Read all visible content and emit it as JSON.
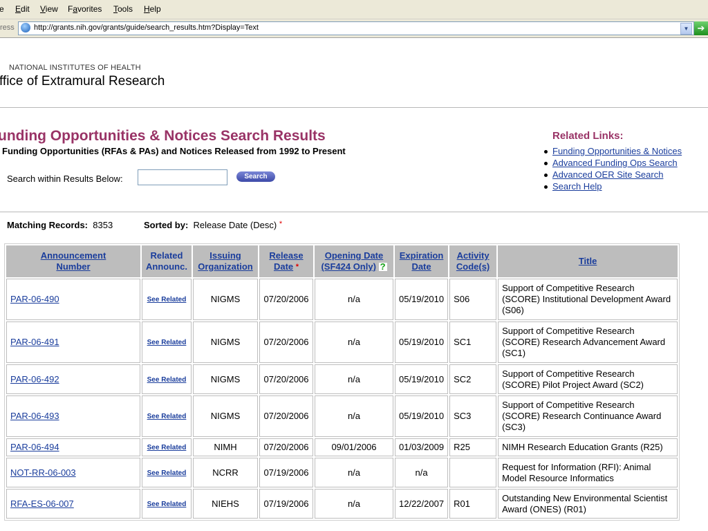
{
  "menu": {
    "items": [
      {
        "prefix": "",
        "key": "",
        "rest": "e"
      },
      {
        "prefix": "",
        "key": "E",
        "rest": "dit"
      },
      {
        "prefix": "",
        "key": "V",
        "rest": "iew"
      },
      {
        "prefix": "F",
        "key": "a",
        "rest": "vorites"
      },
      {
        "prefix": "",
        "key": "T",
        "rest": "ools"
      },
      {
        "prefix": "",
        "key": "H",
        "rest": "elp"
      }
    ]
  },
  "address": {
    "label": "ress",
    "url": "http://grants.nih.gov/grants/guide/search_results.htm?Display=Text",
    "go_icon": "go-arrow-icon"
  },
  "header": {
    "agency": "NATIONAL INSTITUTES OF HEALTH",
    "office": "ffice of Extramural Research"
  },
  "search": {
    "title": "unding Opportunities & Notices Search Results",
    "subtitle": "Funding Opportunities (RFAs & PAs) and Notices Released from 1992 to Present",
    "label": "Search within Results Below:",
    "value": "",
    "button": "Search"
  },
  "related": {
    "title": "Related Links:",
    "links": [
      "Funding Opportunities & Notices",
      "Advanced Funding Ops Search",
      "Advanced OER Site Search",
      "Search Help"
    ]
  },
  "summary": {
    "matching_label": "Matching Records:",
    "matching_value": "8353",
    "sorted_label": "Sorted by:",
    "sorted_value": "Release Date (Desc)",
    "star": "*"
  },
  "table": {
    "headers": {
      "announcement_l1": "Announcement",
      "announcement_l2": "Number",
      "related_l1": "Related",
      "related_l2": "Announc.",
      "issuing_l1": "Issuing",
      "issuing_l2": "Organization",
      "release_l1": "Release",
      "release_l2": "Date",
      "opening_l1": "Opening Date",
      "opening_l2": "(SF424 Only)",
      "opening_q": "?",
      "expiration_l1": "Expiration",
      "expiration_l2": "Date",
      "activity_l1": "Activity",
      "activity_l2": "Code(s)",
      "title": "Title",
      "star": "*"
    },
    "rows": [
      {
        "number": "PAR-06-490",
        "related": "See Related",
        "org": "NIGMS",
        "release": "07/20/2006",
        "opening": "n/a",
        "expiration": "05/19/2010",
        "activity": "S06",
        "title": "Support of Competitive Research (SCORE) Institutional Development Award (S06)"
      },
      {
        "number": "PAR-06-491",
        "related": "See Related",
        "org": "NIGMS",
        "release": "07/20/2006",
        "opening": "n/a",
        "expiration": "05/19/2010",
        "activity": "SC1",
        "title": "Support of Competitive Research (SCORE) Research Advancement Award (SC1)"
      },
      {
        "number": "PAR-06-492",
        "related": "See Related",
        "org": "NIGMS",
        "release": "07/20/2006",
        "opening": "n/a",
        "expiration": "05/19/2010",
        "activity": "SC2",
        "title": "Support of Competitive Research (SCORE) Pilot Project Award (SC2)"
      },
      {
        "number": "PAR-06-493",
        "related": "See Related",
        "org": "NIGMS",
        "release": "07/20/2006",
        "opening": "n/a",
        "expiration": "05/19/2010",
        "activity": "SC3",
        "title": "Support of Competitive Research (SCORE) Research Continuance Award (SC3)"
      },
      {
        "number": "PAR-06-494",
        "related": "See Related",
        "org": "NIMH",
        "release": "07/20/2006",
        "opening": "09/01/2006",
        "expiration": "01/03/2009",
        "activity": "R25",
        "title": "NIMH Research Education Grants (R25)"
      },
      {
        "number": "NOT-RR-06-003",
        "related": "See Related",
        "org": "NCRR",
        "release": "07/19/2006",
        "opening": "n/a",
        "expiration": "n/a",
        "activity": "",
        "title": "Request for Information (RFI): Animal Model Resource Informatics"
      },
      {
        "number": "RFA-ES-06-007",
        "related": "See Related",
        "org": "NIEHS",
        "release": "07/19/2006",
        "opening": "n/a",
        "expiration": "12/22/2007",
        "activity": "R01",
        "title": "Outstanding New Environmental Scientist Award (ONES) (R01)"
      }
    ]
  }
}
